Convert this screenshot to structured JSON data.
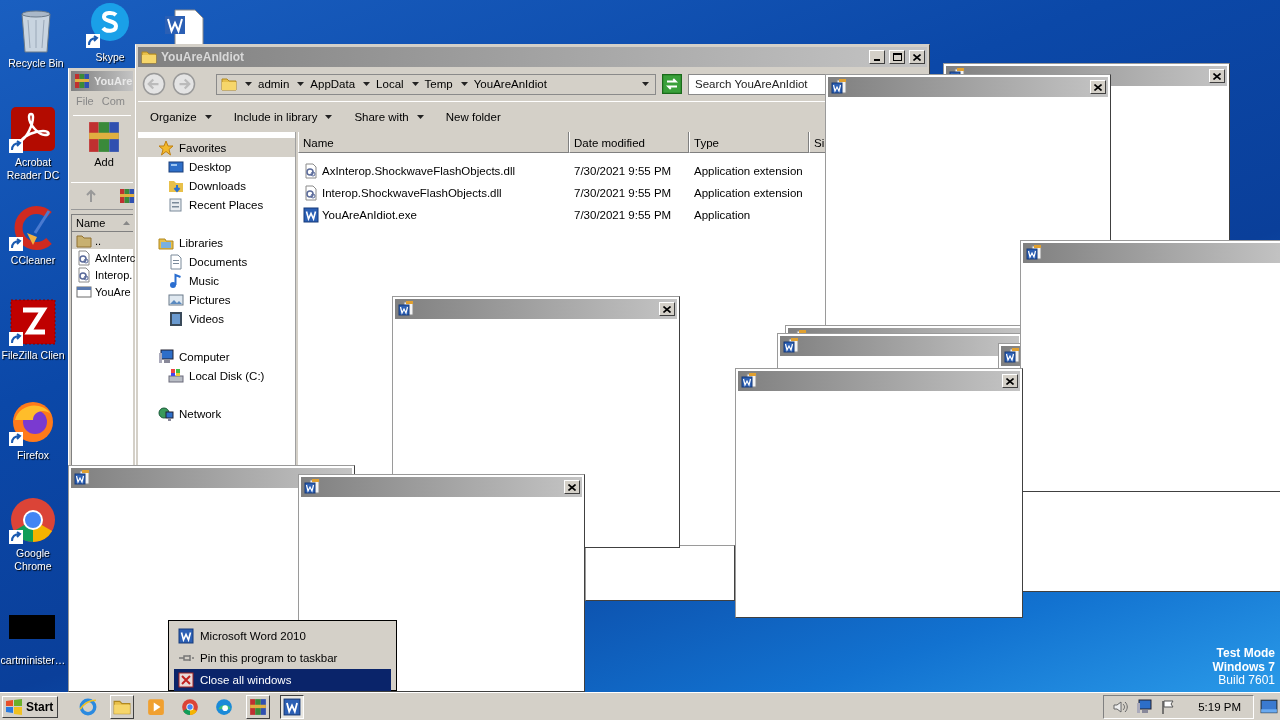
{
  "desktop_icons": [
    {
      "label": "Recycle Bin",
      "kind": "recycle"
    },
    {
      "label": "Skype",
      "kind": "skype"
    },
    {
      "kind": "document"
    },
    {
      "label": "Acrobat Reader DC",
      "kind": "acrobat"
    },
    {
      "label": "CCleaner",
      "kind": "ccleaner"
    },
    {
      "label": "FileZilla Clien",
      "kind": "filezilla"
    },
    {
      "label": "Firefox",
      "kind": "firefox"
    },
    {
      "label": "Google Chrome",
      "kind": "chrome"
    },
    {
      "label": "cartminister…",
      "kind": "blank"
    }
  ],
  "winrar": {
    "title": "YouAre",
    "menu": [
      "File",
      "Com"
    ],
    "toolbar": [
      "Add"
    ],
    "columns": [
      "Name"
    ],
    "rows": [
      {
        "name": "..",
        "kind": "up",
        "selected": true
      },
      {
        "name": "AxInterc",
        "kind": "dll",
        "selected": false
      },
      {
        "name": "Interop.",
        "kind": "dll",
        "selected": false
      },
      {
        "name": "YouAre",
        "kind": "exe",
        "selected": false
      }
    ]
  },
  "explorer": {
    "title": "YouAreAnIdiot",
    "breadcrumbs": [
      "admin",
      "AppData",
      "Local",
      "Temp",
      "YouAreAnIdiot"
    ],
    "search": {
      "placeholder": "Search YouAreAnIdiot"
    },
    "toolbar": [
      {
        "label": "Organize",
        "dropdown": true
      },
      {
        "label": "Include in library",
        "dropdown": true
      },
      {
        "label": "Share with",
        "dropdown": true
      },
      {
        "label": "New folder",
        "dropdown": false
      }
    ],
    "nav": [
      {
        "label": "Favorites",
        "kind": "star",
        "selected": true,
        "children": [
          {
            "label": "Desktop",
            "kind": "desktop",
            "selected": false
          },
          {
            "label": "Downloads",
            "kind": "downloads",
            "selected": false
          },
          {
            "label": "Recent Places",
            "kind": "recent",
            "selected": false
          }
        ]
      },
      {
        "label": "Libraries",
        "kind": "libraries",
        "selected": false,
        "children": [
          {
            "label": "Documents",
            "kind": "documents",
            "selected": false
          },
          {
            "label": "Music",
            "kind": "music",
            "selected": false
          },
          {
            "label": "Pictures",
            "kind": "pictures",
            "selected": false
          },
          {
            "label": "Videos",
            "kind": "videos",
            "selected": false
          }
        ]
      },
      {
        "label": "Computer",
        "kind": "computer",
        "selected": false,
        "children": [
          {
            "label": "Local Disk (C:)",
            "kind": "disk",
            "selected": false
          }
        ]
      },
      {
        "label": "Network",
        "kind": "network",
        "selected": false
      }
    ],
    "columns": [
      "Name",
      "Date modified",
      "Type",
      "Si"
    ],
    "files": [
      {
        "name": "AxInterop.ShockwaveFlashObjects.dll",
        "date": "7/30/2021 9:55 PM",
        "type": "Application extension",
        "kind": "dll"
      },
      {
        "name": "Interop.ShockwaveFlashObjects.dll",
        "date": "7/30/2021 9:55 PM",
        "type": "Application extension",
        "kind": "dll"
      },
      {
        "name": "YouAreAnIdiot.exe",
        "date": "7/30/2021 9:55 PM",
        "type": "Application",
        "kind": "word"
      }
    ]
  },
  "jump_list": [
    {
      "label": "Microsoft Word 2010",
      "kind": "word",
      "selected": false
    },
    {
      "label": "Pin this program to taskbar",
      "kind": "pin",
      "selected": false
    },
    {
      "label": "Close all windows",
      "kind": "close",
      "selected": true
    }
  ],
  "os_notice": [
    "Test Mode",
    "Windows 7",
    "Build 7601"
  ],
  "taskbar": {
    "start": "Start",
    "clock": "5:19 PM",
    "buttons": [
      {
        "kind": "ie",
        "window": false,
        "pressed": false
      },
      {
        "kind": "folder",
        "window": true,
        "pressed": false
      },
      {
        "kind": "media",
        "window": false,
        "pressed": false
      },
      {
        "kind": "chrome",
        "window": false,
        "pressed": false
      },
      {
        "kind": "edge",
        "window": false,
        "pressed": false
      },
      {
        "kind": "winrar",
        "window": true,
        "pressed": false
      },
      {
        "kind": "word",
        "window": true,
        "pressed": true
      }
    ]
  }
}
